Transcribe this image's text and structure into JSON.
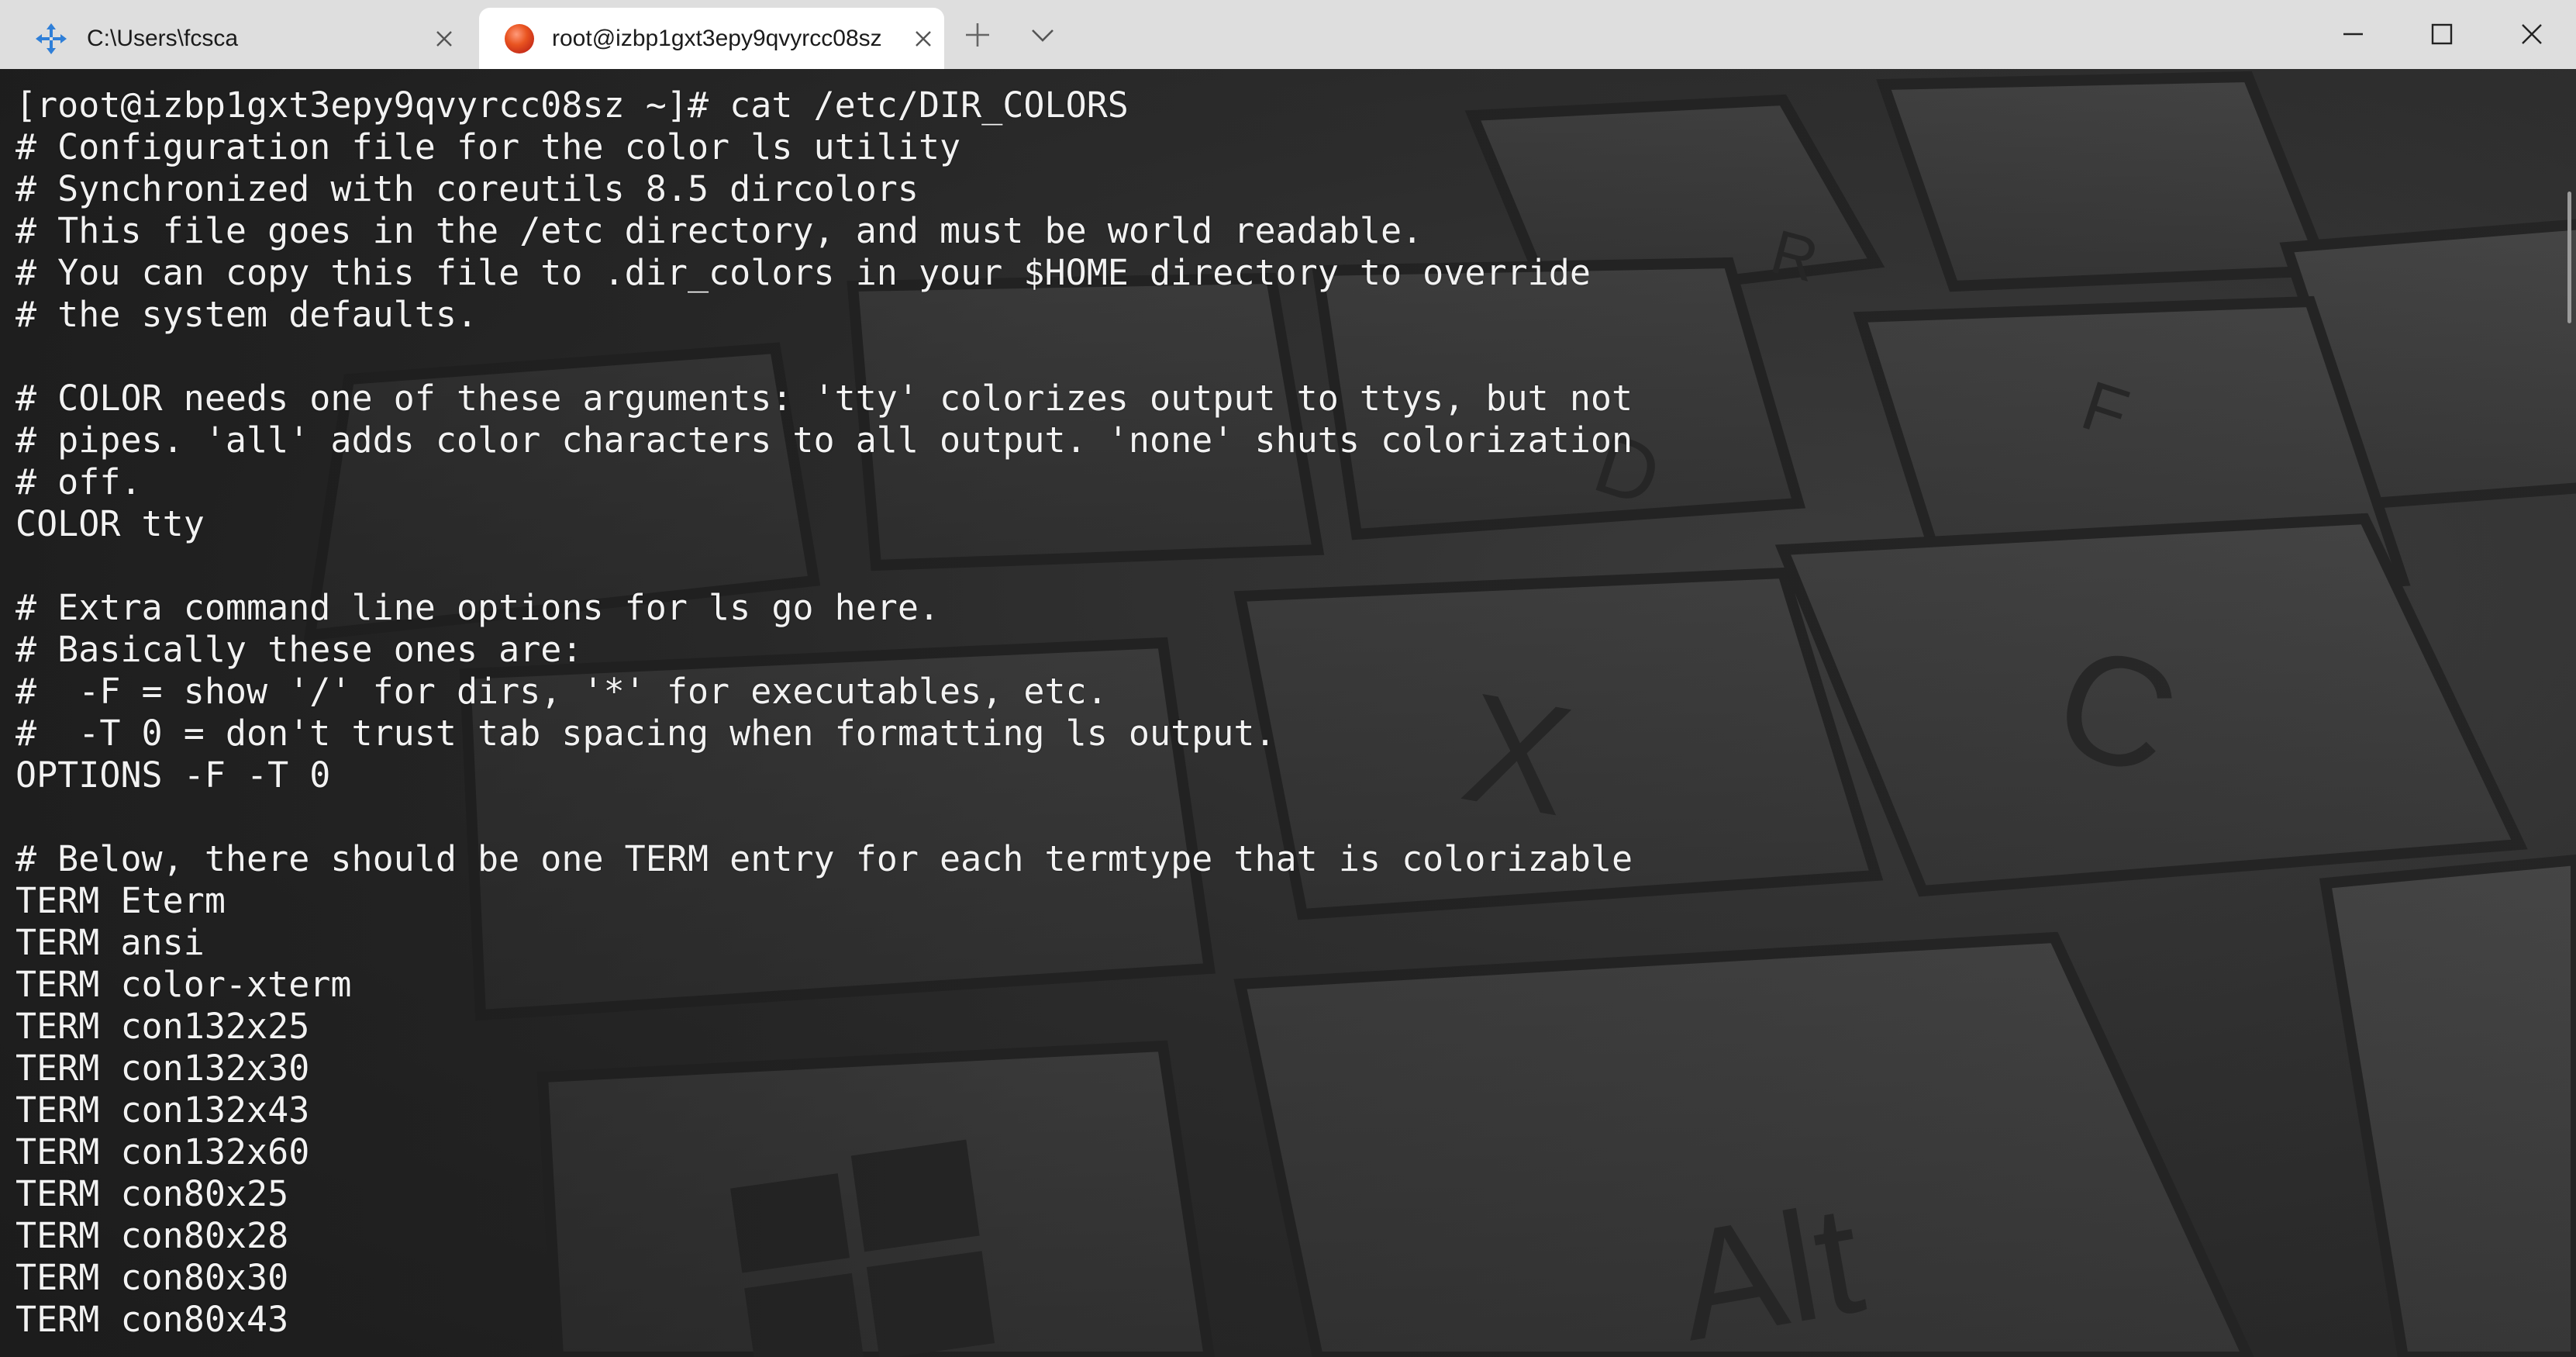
{
  "tabs": [
    {
      "title": "C:\\Users\\fcsca",
      "icon": "cross-arrows-icon",
      "active": false
    },
    {
      "title": "root@izbp1gxt3epy9qvyrcc08sz",
      "icon": "ubuntu-orange-circle-icon",
      "active": true
    }
  ],
  "titlebar": {
    "new_tab_icon": "plus-icon",
    "dropdown_icon": "chevron-down-icon",
    "minimize_icon": "minimize-icon",
    "maximize_icon": "maximize-icon",
    "close_icon": "close-icon"
  },
  "terminal": {
    "lines": [
      "[root@izbp1gxt3epy9qvyrcc08sz ~]# cat /etc/DIR_COLORS",
      "# Configuration file for the color ls utility",
      "# Synchronized with coreutils 8.5 dircolors",
      "# This file goes in the /etc directory, and must be world readable.",
      "# You can copy this file to .dir_colors in your $HOME directory to override",
      "# the system defaults.",
      "",
      "# COLOR needs one of these arguments: 'tty' colorizes output to ttys, but not",
      "# pipes. 'all' adds color characters to all output. 'none' shuts colorization",
      "# off.",
      "COLOR tty",
      "",
      "# Extra command line options for ls go here.",
      "# Basically these ones are:",
      "#  -F = show '/' for dirs, '*' for executables, etc.",
      "#  -T 0 = don't trust tab spacing when formatting ls output.",
      "OPTIONS -F -T 0",
      "",
      "# Below, there should be one TERM entry for each termtype that is colorizable",
      "TERM Eterm",
      "TERM ansi",
      "TERM color-xterm",
      "TERM con132x25",
      "TERM con132x30",
      "TERM con132x43",
      "TERM con132x60",
      "TERM con80x25",
      "TERM con80x28",
      "TERM con80x30",
      "TERM con80x43"
    ]
  },
  "colors": {
    "titlebar_bg": "#dedede",
    "active_tab_bg": "#ffffff",
    "terminal_fg": "#f2f2f2",
    "ubuntu_orange": "#e95420",
    "terminal_icon_blue": "#1e88e5"
  }
}
